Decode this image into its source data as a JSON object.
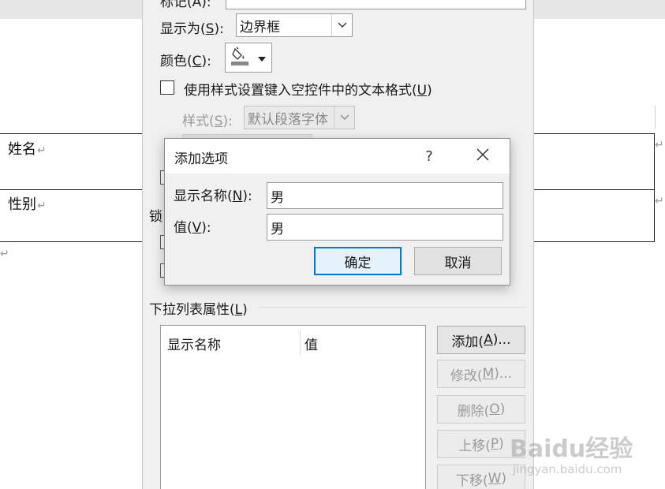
{
  "document": {
    "row1_label": "姓名",
    "row2_label": "性别",
    "return_mark": "↵"
  },
  "properties_dialog": {
    "top_label": "标记(A):",
    "show_as_label": "显示为(S):",
    "show_as_value": "边界框",
    "color_label": "颜色(C):",
    "use_style_label": "使用样式设置键入空控件中的文本格式(U)",
    "style_label": "样式(S):",
    "style_value": "默认段落字体",
    "lock_label": "锁",
    "dropdown_section_label": "下拉列表属性(L)",
    "list_columns": [
      "显示名称",
      "值"
    ],
    "buttons": {
      "add": "添加(A)...",
      "modify": "修改(M)...",
      "delete": "删除(O)",
      "move_up": "上移(P)",
      "move_down": "下移(W)"
    }
  },
  "add_option_dialog": {
    "title": "添加选项",
    "help": "?",
    "display_name_label": "显示名称(N):",
    "display_name_value": "男",
    "value_label": "值(V):",
    "value_value": "男",
    "ok": "确定",
    "cancel": "取消"
  },
  "watermark": {
    "brand": "Baidu经验",
    "url": "jingyan.baidu.com"
  },
  "colors": {
    "accent": "#0078d7",
    "dialog_bg": "#f0f0f0",
    "disabled_text": "#9a9a9a"
  }
}
